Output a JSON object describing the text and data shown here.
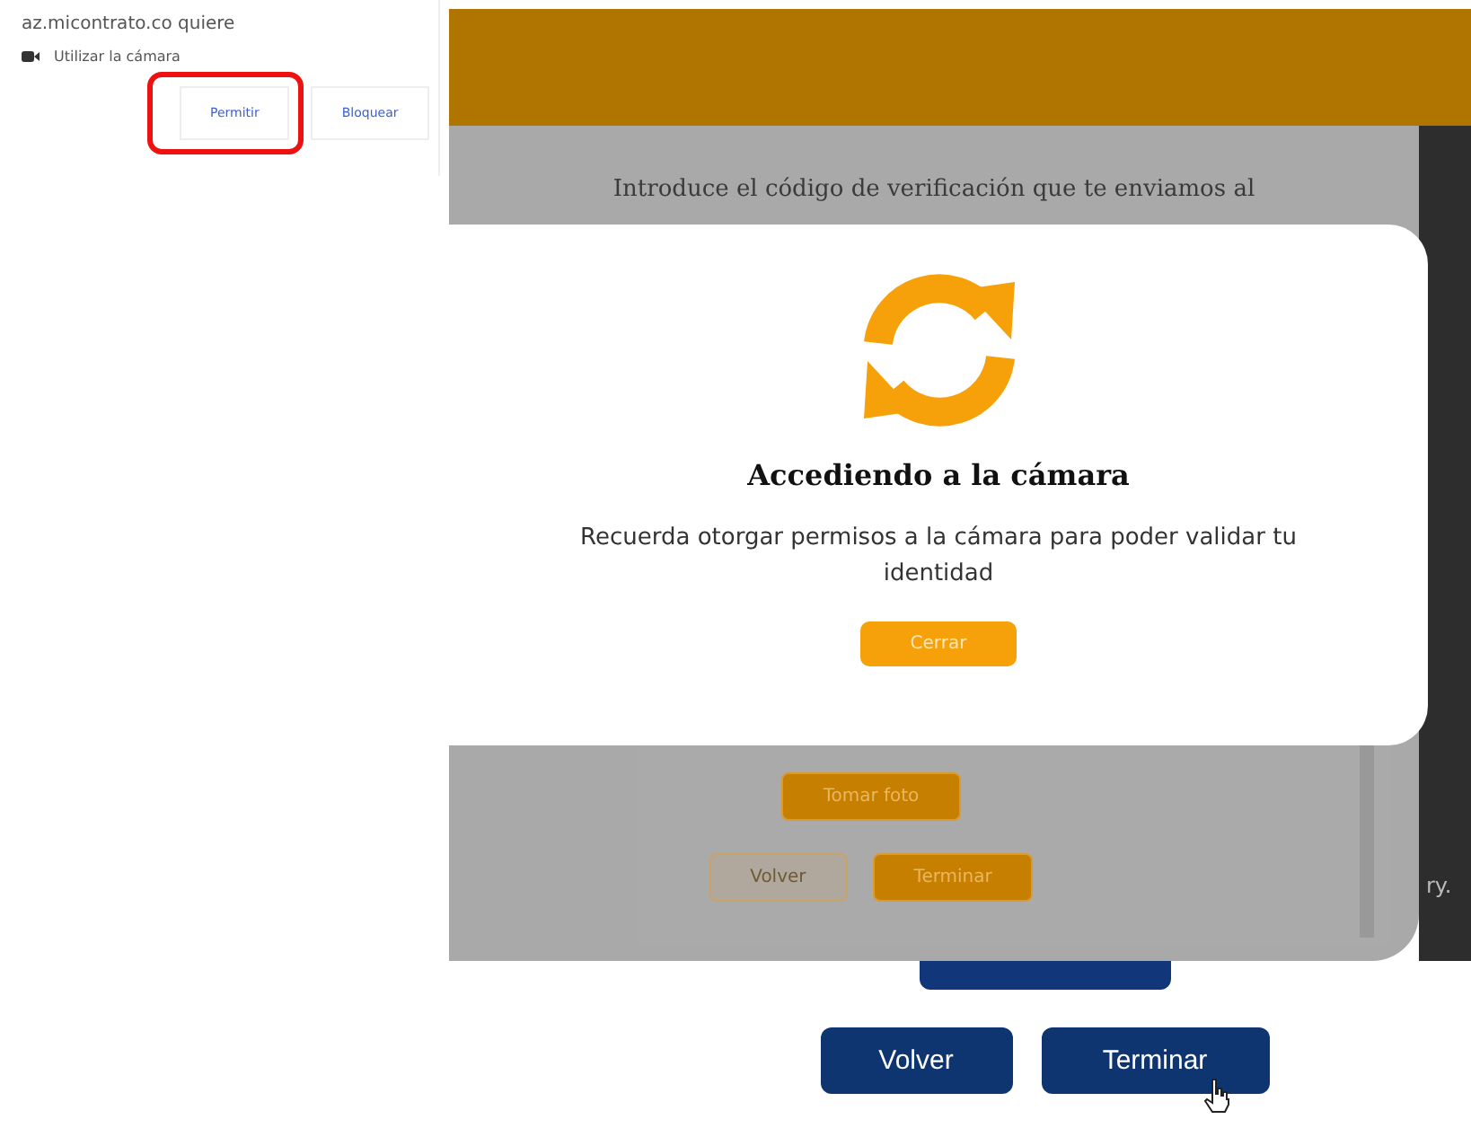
{
  "permission_prompt": {
    "origin": "az.micontrato.co quiere",
    "request": "Utilizar la cámara",
    "buttons": [
      {
        "label": "Permitir",
        "highlighted": true
      },
      {
        "label": "Bloquear",
        "highlighted": false
      }
    ]
  },
  "background_page": {
    "instruction": "Introduce el código de verificación que te enviamos al",
    "side_text": "ry.",
    "buttons": [
      {
        "label": "Tomar foto",
        "kind": "filled"
      },
      {
        "label": "Volver",
        "kind": "outline"
      },
      {
        "label": "Terminar",
        "kind": "filled"
      }
    ]
  },
  "modal": {
    "title": "Accediendo a la cámara",
    "message": "Recuerda otorgar permisos a la cámara para poder validar tu identidad",
    "button": "Cerrar"
  },
  "footer_buttons": [
    {
      "label": "Volver"
    },
    {
      "label": "Terminar"
    }
  ]
}
